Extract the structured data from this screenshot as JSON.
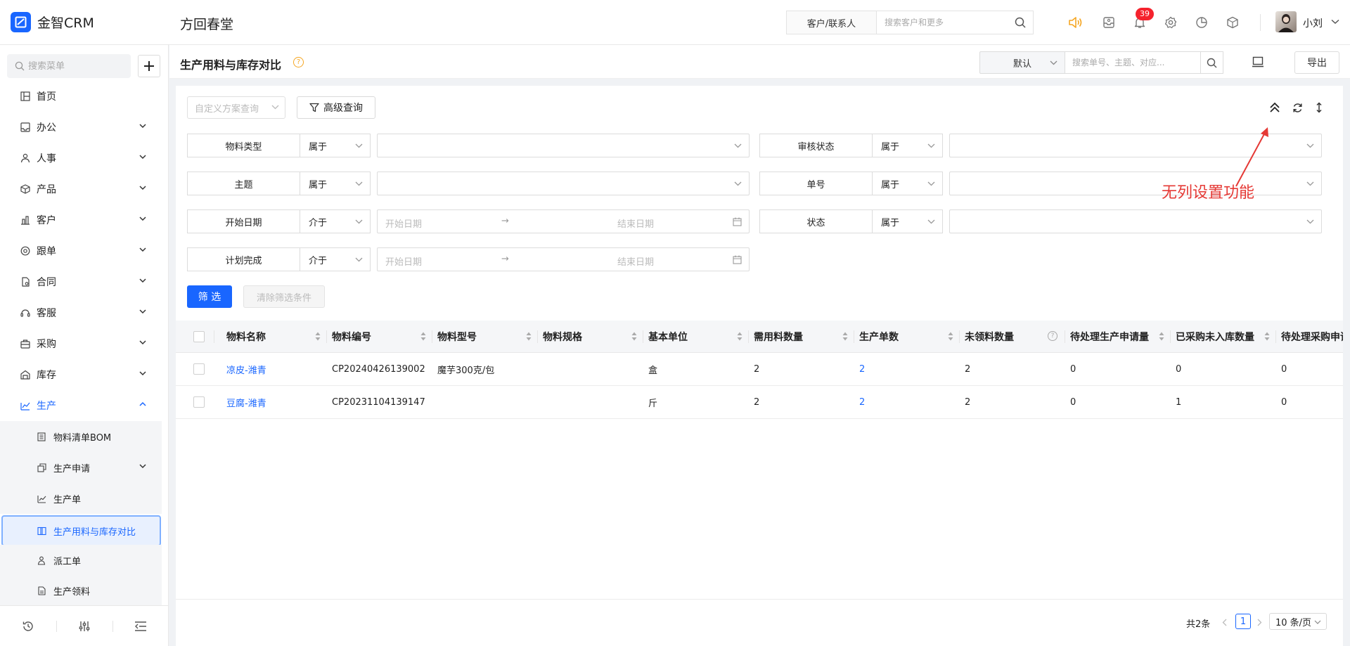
{
  "app": {
    "brand": "金智CRM",
    "company": "方回春堂",
    "search_type": "客户/联系人",
    "search_placeholder": "搜索客户和更多",
    "notification_count": "39",
    "user_name": "小刘"
  },
  "sidebar": {
    "search_placeholder": "搜索菜单",
    "items": [
      {
        "label": "首页",
        "icon": "home-icon"
      },
      {
        "label": "办公",
        "icon": "office-icon"
      },
      {
        "label": "人事",
        "icon": "people-icon"
      },
      {
        "label": "产品",
        "icon": "product-icon"
      },
      {
        "label": "客户",
        "icon": "customer-icon"
      },
      {
        "label": "跟单",
        "icon": "follow-icon"
      },
      {
        "label": "合同",
        "icon": "contract-icon"
      },
      {
        "label": "客服",
        "icon": "service-icon"
      },
      {
        "label": "采购",
        "icon": "purchase-icon"
      },
      {
        "label": "库存",
        "icon": "inventory-icon"
      },
      {
        "label": "生产",
        "icon": "production-icon"
      }
    ],
    "subitems": [
      {
        "label": "物料清单BOM",
        "icon": "bom-icon"
      },
      {
        "label": "生产申请",
        "icon": "request-icon"
      },
      {
        "label": "生产单",
        "icon": "order-icon"
      },
      {
        "label": "生产用料与库存对比",
        "icon": "compare-icon"
      },
      {
        "label": "派工单",
        "icon": "dispatch-icon"
      },
      {
        "label": "生产领料",
        "icon": "pick-icon"
      }
    ]
  },
  "page": {
    "title": "生产用料与库存对比",
    "help": "?",
    "view_select": "默认",
    "search_placeholder": "搜索单号、主题、对应...",
    "export_label": "导出"
  },
  "filters": {
    "custom_query_placeholder": "自定义方案查询",
    "advanced_query": "高级查询",
    "fields": [
      {
        "label": "物料类型",
        "op": "属于"
      },
      {
        "label": "审核状态",
        "op": "属于"
      },
      {
        "label": "主题",
        "op": "属于"
      },
      {
        "label": "单号",
        "op": "属于"
      },
      {
        "label": "开始日期",
        "op": "介于"
      },
      {
        "label": "状态",
        "op": "属于"
      },
      {
        "label": "计划完成",
        "op": "介于"
      }
    ],
    "date_start_placeholder": "开始日期",
    "date_end_placeholder": "结束日期",
    "date_arrow": "→",
    "filter_button": "筛 选",
    "clear_button": "清除筛选条件"
  },
  "annotation": "无列设置功能",
  "annotation_color": "#e53935",
  "table": {
    "columns": [
      "物料名称",
      "物料编号",
      "物料型号",
      "物料规格",
      "基本单位",
      "需用料数量",
      "生产单数",
      "未领料数量",
      "待处理生产申请量",
      "已采购未入库数量",
      "待处理采购申请"
    ],
    "unreceived_help": "?",
    "rows": [
      [
        "凉皮-潍青",
        "CP20240426139002",
        "魔芋300克/包",
        "",
        "盒",
        "2",
        "2",
        "2",
        "0",
        "0",
        "0"
      ],
      [
        "豆腐-潍青",
        "CP20231104139147",
        "",
        "",
        "斤",
        "2",
        "2",
        "2",
        "0",
        "1",
        "0"
      ]
    ]
  },
  "pagination": {
    "total": "共2条",
    "current": "1",
    "page_size": "10 条/页"
  },
  "colors": {
    "primary": "#1966ff",
    "badge": "#f5222d",
    "speaker": "#f5a623"
  }
}
